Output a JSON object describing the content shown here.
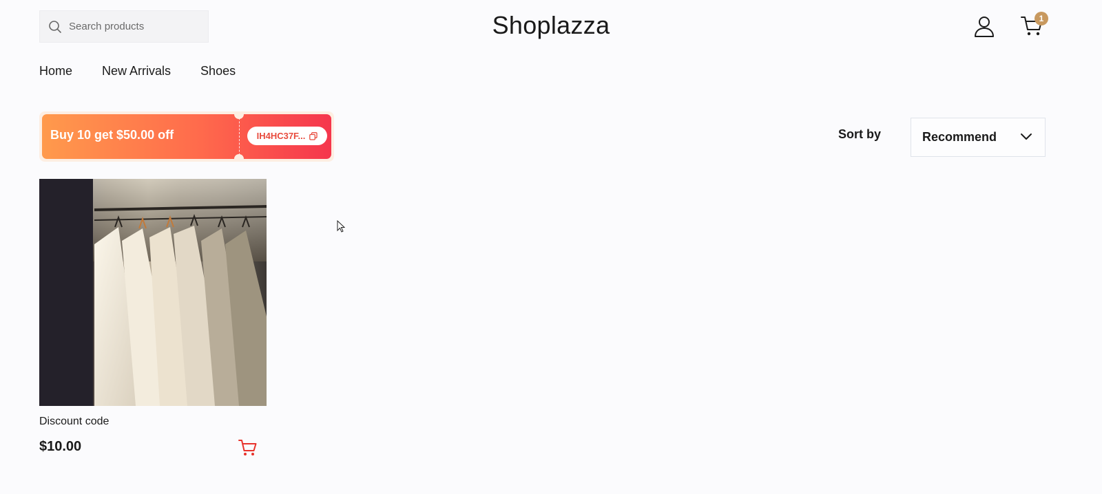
{
  "header": {
    "search": {
      "placeholder": "Search products",
      "icon": "search-icon"
    },
    "brand": "Shoplazza",
    "account_icon": "user-icon",
    "cart": {
      "icon": "cart-icon",
      "count": "1",
      "badge_color": "#c8995f"
    }
  },
  "nav": {
    "items": [
      {
        "label": "Home"
      },
      {
        "label": "New Arrivals"
      },
      {
        "label": "Shoes"
      }
    ]
  },
  "coupon": {
    "title": "Buy 10 get $50.00 off",
    "code": "IH4HC37F...",
    "copy_icon": "copy-icon",
    "gradient_start": "#ff9a4c",
    "gradient_end": "#f5364d"
  },
  "sort": {
    "label": "Sort by",
    "value": "Recommend",
    "icon": "chevron-down-icon"
  },
  "products": [
    {
      "title": "Discount code",
      "price": "$10.00",
      "cart_icon": "add-to-cart-icon",
      "accent_color": "#e8322b"
    }
  ]
}
